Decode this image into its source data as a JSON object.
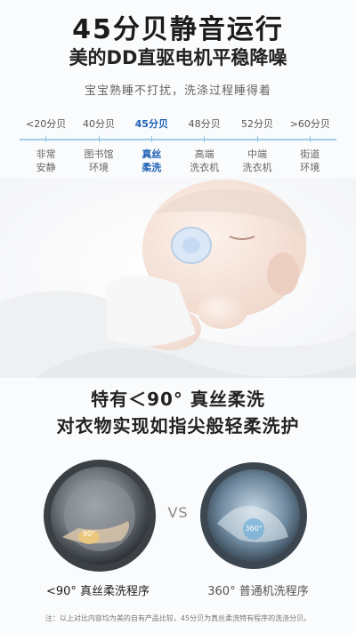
{
  "header": {
    "title": "45分贝静音运行",
    "subtitle": "美的DD直驱电机平稳降噪",
    "tagline": "宝宝熟睡不打扰，洗涤过程睡得着"
  },
  "noise_scale": {
    "levels": [
      {
        "db": "<20分贝",
        "desc": "非常\n安静"
      },
      {
        "db": "40分贝",
        "desc": "图书馆\n环境"
      },
      {
        "db": "45分贝",
        "desc": "真丝\n柔洗"
      },
      {
        "db": "48分贝",
        "desc": "高端\n洗衣机"
      },
      {
        "db": "52分贝",
        "desc": "中端\n洗衣机"
      },
      {
        "db": ">60分贝",
        "desc": "街道\n环境"
      }
    ],
    "active_index": 2,
    "accent_color": "#1a5fb4",
    "line_color": "#9fd0e8"
  },
  "feature": {
    "title": "特有＜90° 真丝柔洗",
    "subtitle": "对衣物实现如指尖般轻柔洗护"
  },
  "comparison": {
    "vs": "VS",
    "left_badge": "90°",
    "right_badge": "360°",
    "left_caption": "<90° 真丝柔洗程序",
    "right_caption": "360° 普通机洗程序"
  },
  "footnote": "注：以上对比内容均为美的自有产品比较，45分贝为真丝柔洗特有程序的洗涤分贝。"
}
